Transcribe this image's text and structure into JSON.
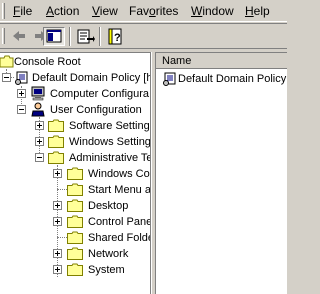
{
  "menubar": {
    "items": [
      {
        "label": "File",
        "u": "F",
        "rest": "ile"
      },
      {
        "label": "Action",
        "u": "A",
        "rest": "ction"
      },
      {
        "label": "View",
        "u": "V",
        "rest": "iew"
      },
      {
        "label": "Favorites",
        "pre": "Fav",
        "u": "o",
        "rest": "rites"
      },
      {
        "label": "Window",
        "u": "W",
        "rest": "indow"
      },
      {
        "label": "Help",
        "u": "H",
        "rest": "elp"
      }
    ]
  },
  "toolbar": {
    "buttons": [
      "back-icon",
      "forward-icon",
      "show-hide-console-tree-icon",
      "export-list-icon",
      "help-icon"
    ]
  },
  "tree": {
    "items": [
      {
        "label": "Console Root"
      },
      {
        "label": "Default Domain Policy [h"
      },
      {
        "label": "Computer Configura"
      },
      {
        "label": "User Configuration"
      },
      {
        "label": "Software Setting"
      },
      {
        "label": "Windows Setting"
      },
      {
        "label": "Administrative Te"
      },
      {
        "label": "Windows Co"
      },
      {
        "label": "Start Menu a"
      },
      {
        "label": "Desktop"
      },
      {
        "label": "Control Pane"
      },
      {
        "label": "Shared Folde"
      },
      {
        "label": "Network"
      },
      {
        "label": "System"
      }
    ]
  },
  "details": {
    "column_header": "Name",
    "items": [
      {
        "label": "Default Domain Policy ["
      }
    ]
  },
  "colors": {
    "window_bg": "#d4d0c8",
    "folder_fill": "#ffff99",
    "folder_edge": "#808000"
  }
}
